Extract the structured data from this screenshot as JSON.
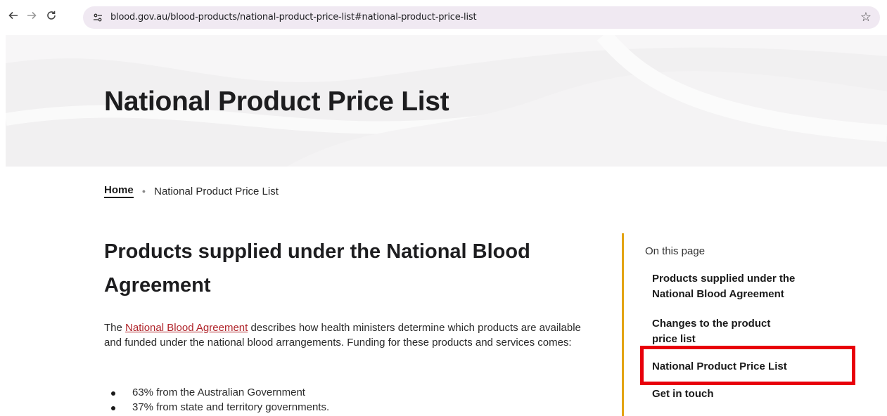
{
  "browser": {
    "url": "blood.gov.au/blood-products/national-product-price-list#national-product-price-list",
    "back_icon": "arrow-left-icon",
    "forward_icon": "arrow-right-icon",
    "reload_icon": "reload-icon",
    "site_info_icon": "tune-icon",
    "bookmark_icon": "star-icon"
  },
  "hero": {
    "title": "National Product Price List"
  },
  "breadcrumb": {
    "home": "Home",
    "current": "National Product Price List"
  },
  "main": {
    "heading": "Products supplied under the National Blood Agreement",
    "intro_prefix": "The ",
    "intro_link": "National Blood Agreement",
    "intro_suffix": " describes how health ministers determine which products are available and funded under the national blood arrangements. Funding for these products and services comes:",
    "bullets": [
      "63% from the Australian Government",
      "37% from state and territory governments."
    ]
  },
  "sidebar": {
    "title": "On this page",
    "items": [
      "Products supplied under the National Blood Agreement",
      "Changes to the product price list",
      "National Product Price List",
      "Get in touch"
    ]
  },
  "colors": {
    "accent_gold": "#e3a413",
    "link_red": "#b0242a",
    "highlight_red": "#e8000b",
    "omnibox_bg": "#f0e9f2"
  }
}
